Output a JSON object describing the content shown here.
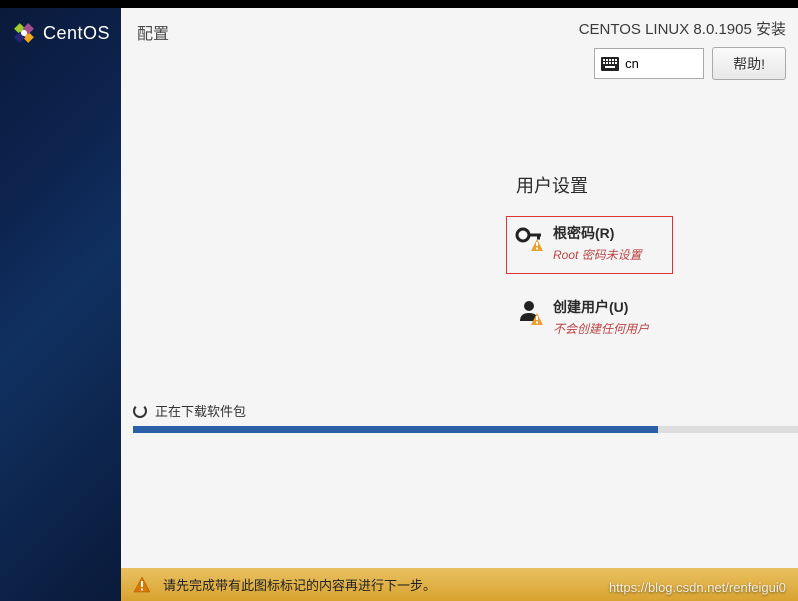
{
  "sidebar": {
    "brand": "CentOS"
  },
  "header": {
    "left_title": "配置",
    "right_title": "CENTOS LINUX 8.0.1905 安装",
    "locale": "cn",
    "help_label": "帮助!"
  },
  "content": {
    "section_title": "用户设置",
    "options": [
      {
        "title": "根密码(R)",
        "subtitle": "Root 密码未设置"
      },
      {
        "title": "创建用户(U)",
        "subtitle": "不会创建任何用户"
      }
    ]
  },
  "progress": {
    "text": "正在下载软件包",
    "percent": 79
  },
  "bottom": {
    "message": "请先完成带有此图标标记的内容再进行下一步。"
  },
  "watermark": "https://blog.csdn.net/renfeigui0"
}
